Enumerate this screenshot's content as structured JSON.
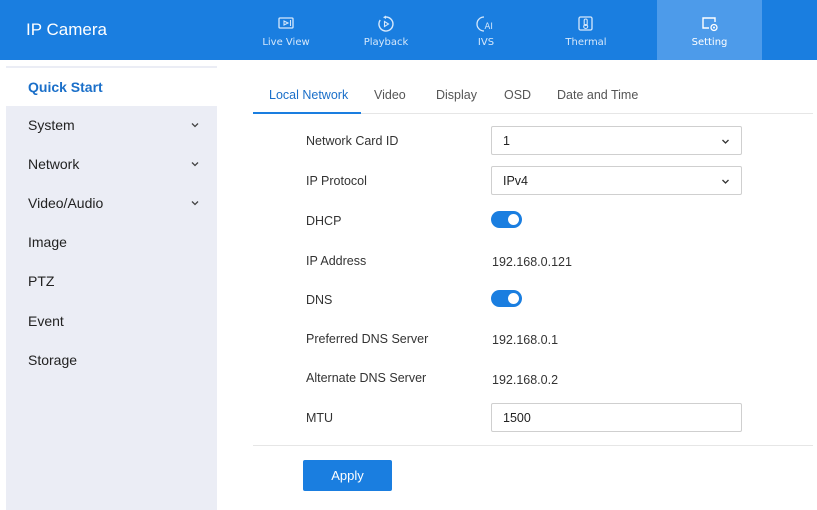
{
  "app": {
    "title": "IP Camera"
  },
  "top_nav": [
    {
      "label": "Live View",
      "icon": "live-view-icon",
      "active": false
    },
    {
      "label": "Playback",
      "icon": "playback-icon",
      "active": false
    },
    {
      "label": "IVS",
      "icon": "ivs-ai-icon",
      "active": false
    },
    {
      "label": "Thermal",
      "icon": "thermal-icon",
      "active": false
    },
    {
      "label": "Setting",
      "icon": "setting-icon",
      "active": true
    }
  ],
  "sidebar": {
    "items": [
      {
        "label": "Quick Start",
        "active": true,
        "expandable": false
      },
      {
        "label": "System",
        "active": false,
        "expandable": true
      },
      {
        "label": "Network",
        "active": false,
        "expandable": true
      },
      {
        "label": "Video/Audio",
        "active": false,
        "expandable": true
      },
      {
        "label": "Image",
        "active": false,
        "expandable": false
      },
      {
        "label": "PTZ",
        "active": false,
        "expandable": false
      },
      {
        "label": "Event",
        "active": false,
        "expandable": false
      },
      {
        "label": "Storage",
        "active": false,
        "expandable": false
      }
    ]
  },
  "tabs": [
    {
      "label": "Local Network",
      "active": true
    },
    {
      "label": "Video",
      "active": false
    },
    {
      "label": "Display",
      "active": false
    },
    {
      "label": "OSD",
      "active": false
    },
    {
      "label": "Date and Time",
      "active": false
    }
  ],
  "form": {
    "network_card_id": {
      "label": "Network Card ID",
      "value": "1"
    },
    "ip_protocol": {
      "label": "IP Protocol",
      "value": "IPv4"
    },
    "dhcp": {
      "label": "DHCP",
      "enabled": true
    },
    "ip_address": {
      "label": "IP Address",
      "value": "192.168.0.121"
    },
    "dns": {
      "label": "DNS",
      "enabled": true
    },
    "preferred_dns": {
      "label": "Preferred DNS Server",
      "value": "192.168.0.1"
    },
    "alternate_dns": {
      "label": "Alternate DNS Server",
      "value": "192.168.0.2"
    },
    "mtu": {
      "label": "MTU",
      "value": "1500"
    }
  },
  "actions": {
    "apply_label": "Apply"
  },
  "colors": {
    "accent": "#1a7ee0",
    "nav_active": "#4d9bea",
    "sidebar_bg": "#ebedf5",
    "active_text": "#1a6fc9"
  }
}
